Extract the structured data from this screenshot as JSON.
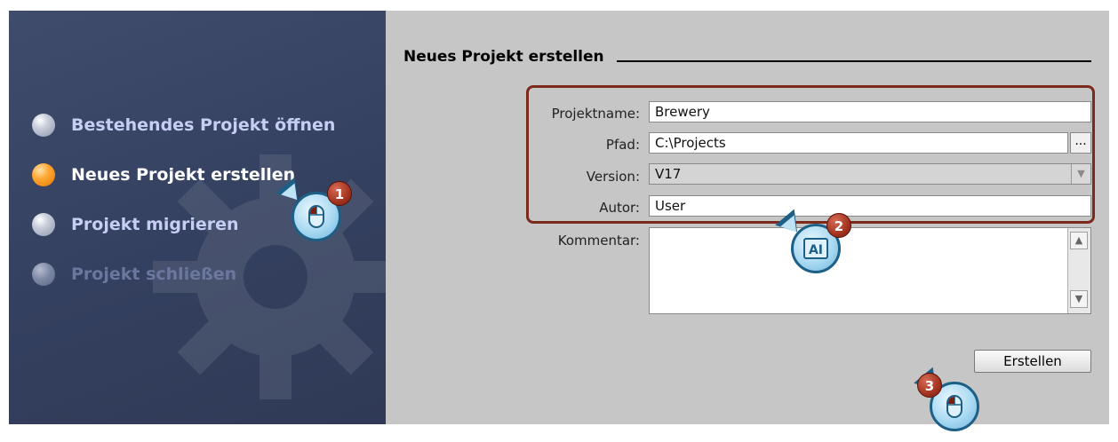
{
  "left_nav": {
    "items": [
      {
        "label": "Bestehendes Projekt öffnen",
        "state": "normal"
      },
      {
        "label": "Neues Projekt erstellen",
        "state": "active"
      },
      {
        "label": "Projekt migrieren",
        "state": "normal"
      },
      {
        "label": "Projekt schließen",
        "state": "disabled"
      }
    ]
  },
  "form": {
    "title": "Neues Projekt erstellen",
    "fields": {
      "projektname": {
        "label": "Projektname:",
        "value": "Brewery"
      },
      "pfad": {
        "label": "Pfad:",
        "value": "C:\\Projects",
        "browse": "..."
      },
      "version": {
        "label": "Version:",
        "value": "V17"
      },
      "autor": {
        "label": "Autor:",
        "value": "User"
      },
      "kommentar": {
        "label": "Kommentar:",
        "value": ""
      }
    },
    "create_label": "Erstellen"
  },
  "callouts": [
    {
      "number": "1",
      "icon": "mouse-icon"
    },
    {
      "number": "2",
      "icon": "keyboard-text-icon"
    },
    {
      "number": "3",
      "icon": "mouse-icon"
    }
  ],
  "colors": {
    "nav_background": "#3a4666",
    "form_background": "#c6c6c6",
    "highlight_border": "#7b2a1c",
    "active_bullet": "#ffa733",
    "callout_border": "#1d5f86"
  }
}
